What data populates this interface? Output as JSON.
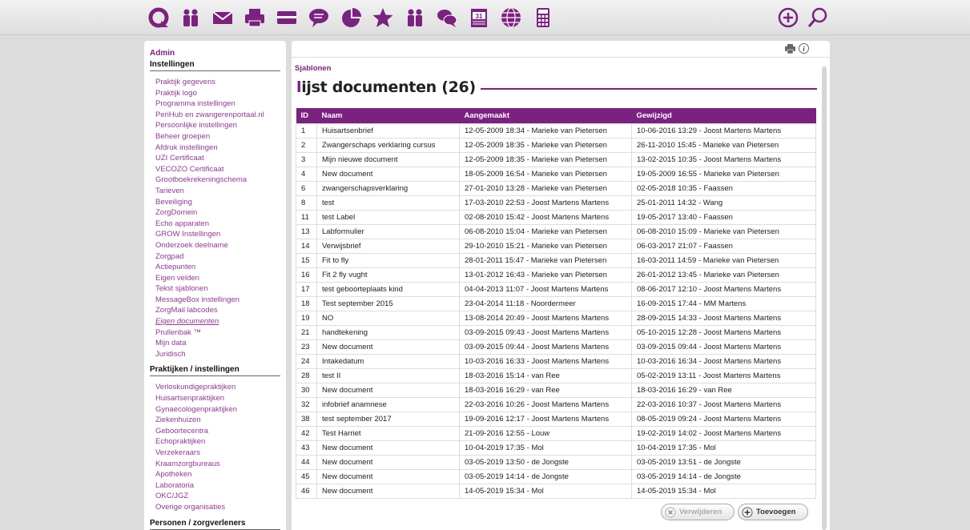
{
  "toolbar": {
    "icons": [
      "refresh-icon",
      "people-icon",
      "mail-icon",
      "printer-icon",
      "card-icon",
      "chat-bubble-icon",
      "pie-chart-icon",
      "star-icon",
      "people-group-icon",
      "conversation-icon",
      "calendar-icon",
      "globe-icon",
      "calculator-icon"
    ],
    "calendar_day": "31",
    "right_icons": [
      "add-circle-icon",
      "search-icon"
    ]
  },
  "colors": {
    "accent": "#7b2180",
    "link": "#8e3a93"
  },
  "sidebar": {
    "admin": "Admin",
    "sections": [
      {
        "title": "Instellingen",
        "items": [
          "Praktijk gegevens",
          "Praktijk logo",
          "Programma instellingen",
          "PeriHub en zwangerenportaal.nl",
          "Persoonlijke instellingen",
          "Beheer groepen",
          "Afdruk instellingen",
          "UZI Certificaat",
          "VECOZO Certificaat",
          "Grootboekrekeningschema",
          "Tarieven",
          "Beveiliging",
          "ZorgDomein",
          "Echo apparaten",
          "GROW Instellingen",
          "Onderzoek deelname",
          "Zorgpad",
          "Actiepunten",
          "Eigen velden",
          "Tekst sjablonen",
          "MessageBox instellingen",
          "ZorgMail labcodes",
          "Eigen documenten",
          "Prullenbak ™",
          "Mijn data",
          "Juridisch"
        ],
        "active": "Eigen documenten"
      },
      {
        "title": "Praktijken / instellingen",
        "items": [
          "Verloskundigepraktijken",
          "Huisartsenpraktijken",
          "Gynaecologenpraktijken",
          "Ziekenhuizen",
          "Geboortecentra",
          "Echopraktijken",
          "Verzekeraars",
          "Kraamzorgbureaus",
          "Apotheken",
          "Laboratoria",
          "OKC/JGZ",
          "Overige organisaties"
        ]
      },
      {
        "title": "Personen / zorgverleners",
        "items": []
      }
    ]
  },
  "main": {
    "breadcrumb": "Sjablonen",
    "title_first": "l",
    "title_rest": "ijst documenten (26)",
    "columns": [
      "ID",
      "Naam",
      "Aangemaakt",
      "Gewijzigd"
    ],
    "rows": [
      [
        "1",
        "Huisartsenbrief",
        "12-05-2009 18:34 - Marieke van Pietersen",
        "10-06-2016 13:29 - Joost Martens Martens"
      ],
      [
        "2",
        "Zwangerschaps verklaring cursus",
        "12-05-2009 18:35 - Marieke van Pietersen",
        "26-11-2010 15:45 - Marieke van Pietersen"
      ],
      [
        "3",
        "Mijn nieuwe document",
        "12-05-2009 18:35 - Marieke van Pietersen",
        "13-02-2015 10:35 - Joost Martens Martens"
      ],
      [
        "4",
        "New document",
        "18-05-2009 16:54 - Marieke van Pietersen",
        "19-05-2009 16:55 - Marieke van Pietersen"
      ],
      [
        "6",
        "zwangerschapsverklaring",
        "27-01-2010 13:28 - Marieke van Pietersen",
        "02-05-2018 10:35 - Faassen"
      ],
      [
        "8",
        "test",
        "17-03-2010 22:53 - Joost Martens Martens",
        "25-01-2011 14:32 - Wang"
      ],
      [
        "11",
        "test Label",
        "02-08-2010 15:42 - Joost Martens Martens",
        "19-05-2017 13:40 - Faassen"
      ],
      [
        "13",
        "Labformulier",
        "06-08-2010 15:04 - Marieke van Pietersen",
        "06-08-2010 15:09 - Marieke van Pietersen"
      ],
      [
        "14",
        "Verwijsbrief",
        "29-10-2010 15:21 - Marieke van Pietersen",
        "06-03-2017 21:07 - Faassen"
      ],
      [
        "15",
        "Fit to fly",
        "28-01-2011 15:47 - Marieke van Pietersen",
        "16-03-2011 14:59 - Marieke van Pietersen"
      ],
      [
        "16",
        "Fit 2 fly vught",
        "13-01-2012 16:43 - Marieke van Pietersen",
        "26-01-2012 13:45 - Marieke van Pietersen"
      ],
      [
        "17",
        "test geboorteplaats kind",
        "04-04-2013 11:07 - Joost Martens Martens",
        "08-06-2017 12:10 - Joost Martens Martens"
      ],
      [
        "18",
        "Test september 2015",
        "23-04-2014 11:18 - Noordermeer",
        "16-09-2015 17:44 - MM Martens"
      ],
      [
        "19",
        "NO",
        "13-08-2014 20:49 - Joost Martens Martens",
        "28-09-2015 14:33 - Joost Martens Martens"
      ],
      [
        "21",
        "handtekening",
        "03-09-2015 09:43 - Joost Martens Martens",
        "05-10-2015 12:28 - Joost Martens Martens"
      ],
      [
        "23",
        "New document",
        "03-09-2015 09:44 - Joost Martens Martens",
        "03-09-2015 09:44 - Joost Martens Martens"
      ],
      [
        "24",
        "Intakedatum",
        "10-03-2016 16:33 - Joost Martens Martens",
        "10-03-2016 16:34 - Joost Martens Martens"
      ],
      [
        "28",
        "test II",
        "18-03-2016 15:14 - van Ree",
        "05-02-2019 13:11 - Joost Martens Martens"
      ],
      [
        "30",
        "New document",
        "18-03-2016 16:29 - van Ree",
        "18-03-2016 16:29 - van Ree"
      ],
      [
        "32",
        "infobrief anamnese",
        "22-03-2016 10:26 - Joost Martens Martens",
        "22-03-2016 10:37 - Joost Martens Martens"
      ],
      [
        "38",
        "test september 2017",
        "19-09-2016 12:17 - Joost Martens Martens",
        "08-05-2019 09:24 - Joost Martens Martens"
      ],
      [
        "42",
        "Test Harriet",
        "21-09-2016 12:55 - Louw",
        "19-02-2019 14:02 - Joost Martens Martens"
      ],
      [
        "43",
        "New document",
        "10-04-2019 17:35 - Mol",
        "10-04-2019 17:35 - Mol"
      ],
      [
        "44",
        "New document",
        "03-05-2019 13:50 - de Jongste",
        "03-05-2019 13:51 - de Jongste"
      ],
      [
        "45",
        "New document",
        "03-05-2019 14:14 - de Jongste",
        "03-05-2019 14:14 - de Jongste"
      ],
      [
        "46",
        "New document",
        "14-05-2019 15:34 - Mol",
        "14-05-2019 15:34 - Mol"
      ]
    ],
    "delete_label": "Verwijderen",
    "add_label": "Toevoegen"
  }
}
